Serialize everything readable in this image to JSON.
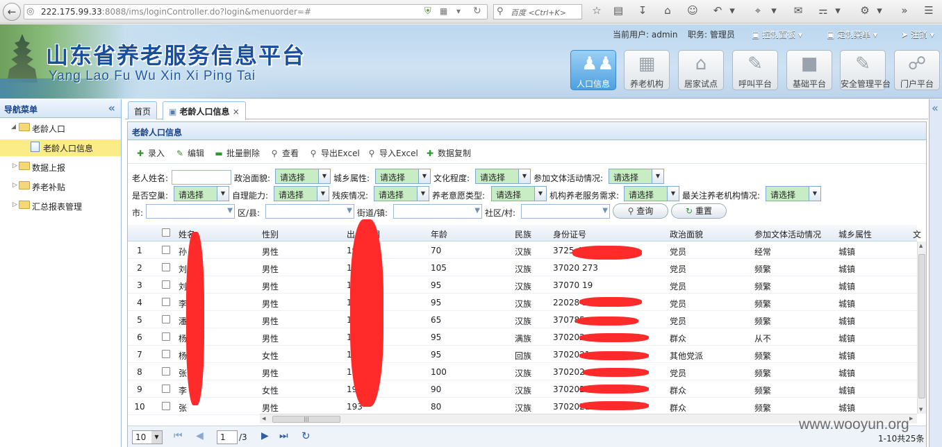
{
  "browser": {
    "url_host": "222.175.99.33",
    "url_rest": ":8088/ims/loginController.do?login&menuorder=#",
    "search_placeholder": "百度 <Ctrl+K>"
  },
  "header": {
    "title": "山东省养老服务信息平台",
    "subtitle": "Yang Lao  Fu Wu Xin Xi Ping Tai",
    "current_user_label": "当前用户: admin",
    "role_label": "职务: 管理员",
    "menu_control": "控制面板",
    "menu_custom": "定制菜单",
    "menu_logout": "注销",
    "modules": [
      {
        "label": "人口信息",
        "icon": "people-icon"
      },
      {
        "label": "养老机构",
        "icon": "building-icon"
      },
      {
        "label": "居家试点",
        "icon": "home-icon"
      },
      {
        "label": "呼叫平台",
        "icon": "edit-icon"
      },
      {
        "label": "基础平台",
        "icon": "cube-icon"
      },
      {
        "label": "安全管理平台",
        "icon": "edit-icon"
      },
      {
        "label": "门户平台",
        "icon": "share-icon"
      }
    ]
  },
  "nav": {
    "title": "导航菜单",
    "items": [
      {
        "label": "老龄人口"
      },
      {
        "label": "老龄人口信息"
      },
      {
        "label": "数据上报"
      },
      {
        "label": "养老补贴"
      },
      {
        "label": "汇总报表管理"
      }
    ]
  },
  "tabs": [
    {
      "label": "首页"
    },
    {
      "label": "老龄人口信息"
    }
  ],
  "panel": {
    "title": "老龄人口信息",
    "toolbar": [
      {
        "label": "录入",
        "icon": "add-icon"
      },
      {
        "label": "编辑",
        "icon": "pencil-icon"
      },
      {
        "label": "批量删除",
        "icon": "remove-icon"
      },
      {
        "label": "查看",
        "icon": "search-icon"
      },
      {
        "label": "导出Excel",
        "icon": "search-icon"
      },
      {
        "label": "导入Excel",
        "icon": "search-icon"
      },
      {
        "label": "数据复制",
        "icon": "add-icon"
      }
    ],
    "filters": {
      "name_label": "老人姓名:",
      "political_label": "政治面貌:",
      "urban_label": "城乡属性:",
      "edu_label": "文化程度:",
      "culture_label": "参加文体活动情况:",
      "empty_nest_label": "是否空巢:",
      "selfcare_label": "自理能力:",
      "disability_label": "残疾情况:",
      "care_type_label": "养老意愿类型:",
      "service_need_label": "机构养老服务需求:",
      "concern_label": "最关注养老机构情况:",
      "city_label": "市:",
      "county_label": "区/县:",
      "street_label": "街道/镇:",
      "community_label": "社区/村:",
      "placeholder_select": "请选择",
      "query_button": "查询",
      "reset_button": "重置"
    }
  },
  "grid": {
    "columns": [
      "姓名",
      "性别",
      "出生日期",
      "年龄",
      "民族",
      "身份证号",
      "政治面貌",
      "参加文体活动情况",
      "城乡属性",
      "文"
    ],
    "rows": [
      {
        "no": "1",
        "name": "孙",
        "gender": "男性",
        "birth": "19",
        "age": "70",
        "ethnic": "汉族",
        "id": "3725 4936",
        "political": "党员",
        "culture": "经常",
        "urban": "城镇"
      },
      {
        "no": "2",
        "name": "刘",
        "gender": "男性",
        "birth": "19",
        "age": "105",
        "ethnic": "汉族",
        "id": "37020 273",
        "political": "党员",
        "culture": "频繁",
        "urban": "城镇"
      },
      {
        "no": "3",
        "name": "刘",
        "gender": "男性",
        "birth": "19",
        "age": "95",
        "ethnic": "汉族",
        "id": "37070 19",
        "political": "党员",
        "culture": "频繁",
        "urban": "城镇"
      },
      {
        "no": "4",
        "name": "李",
        "gender": "男性",
        "birth": "19",
        "age": "95",
        "ethnic": "汉族",
        "id": "22028 5",
        "political": "党员",
        "culture": "频繁",
        "urban": "城镇"
      },
      {
        "no": "5",
        "name": "潘",
        "gender": "男性",
        "birth": "19",
        "age": "65",
        "ethnic": "汉族",
        "id": "370785",
        "political": "党员",
        "culture": "频繁",
        "urban": "城镇"
      },
      {
        "no": "6",
        "name": "杨",
        "gender": "男性",
        "birth": "19",
        "age": "95",
        "ethnic": "满族",
        "id": "370202",
        "political": "群众",
        "culture": "从不",
        "urban": "城镇"
      },
      {
        "no": "7",
        "name": "杨",
        "gender": "女性",
        "birth": "19",
        "age": "95",
        "ethnic": "回族",
        "id": "3702021",
        "political": "其他党派",
        "culture": "频繁",
        "urban": "城镇"
      },
      {
        "no": "8",
        "name": "张",
        "gender": "男性",
        "birth": "19",
        "age": "100",
        "ethnic": "汉族",
        "id": "370202",
        "political": "党员",
        "culture": "频繁",
        "urban": "城镇"
      },
      {
        "no": "9",
        "name": "李",
        "gender": "女性",
        "birth": "192",
        "age": "90",
        "ethnic": "汉族",
        "id": "370202",
        "political": "群众",
        "culture": "频繁",
        "urban": "城镇"
      },
      {
        "no": "10",
        "name": "张",
        "gender": "男性",
        "birth": "193",
        "age": "80",
        "ethnic": "汉族",
        "id": "3702021",
        "political": "群众",
        "culture": "频繁",
        "urban": "城镇"
      }
    ]
  },
  "pager": {
    "page_size": "10",
    "page": "1",
    "total_pages": "/3",
    "summary": "1-10共25条"
  },
  "watermark": "www.wooyun.org"
}
